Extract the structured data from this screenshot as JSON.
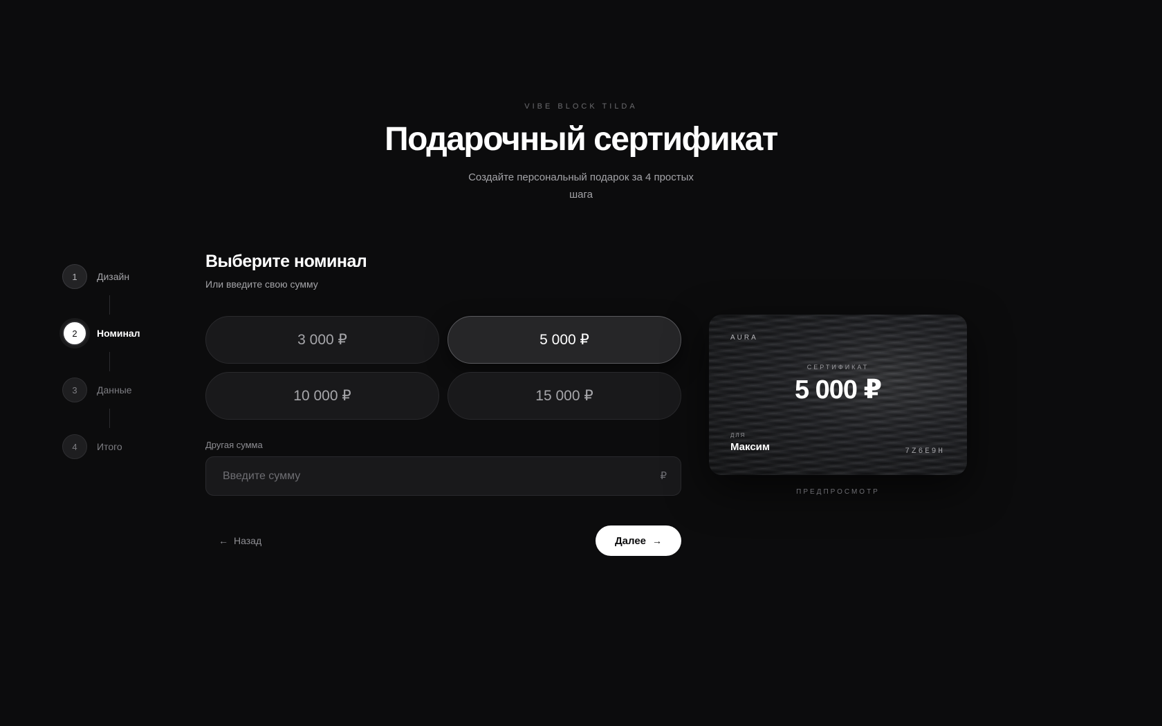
{
  "header": {
    "eyebrow": "VIBE BLOCK TILDA",
    "title": "Подарочный сертификат",
    "subtitle": "Создайте персональный подарок за 4 простых шага"
  },
  "stepper": {
    "steps": [
      {
        "number": "1",
        "label": "Дизайн",
        "state": "done"
      },
      {
        "number": "2",
        "label": "Номинал",
        "state": "active"
      },
      {
        "number": "3",
        "label": "Данные",
        "state": "pending"
      },
      {
        "number": "4",
        "label": "Итого",
        "state": "pending"
      }
    ]
  },
  "main": {
    "title": "Выберите номинал",
    "subtitle": "Или введите свою сумму",
    "amounts": [
      {
        "label": "3 000 ₽",
        "selected": false
      },
      {
        "label": "5 000 ₽",
        "selected": true
      },
      {
        "label": "10 000 ₽",
        "selected": false
      },
      {
        "label": "15 000 ₽",
        "selected": false
      }
    ],
    "custom_amount": {
      "label": "Другая сумма",
      "placeholder": "Введите сумму",
      "value": "",
      "currency": "₽"
    },
    "back_label": "Назад",
    "next_label": "Далее"
  },
  "preview": {
    "brand": "AURA",
    "cert_label": "СЕРТИФИКАТ",
    "amount": "5 000 ₽",
    "for_label": "ДЛЯ",
    "recipient": "Максим",
    "code": "7Z6E9H",
    "caption": "ПРЕДПРОСМОТР"
  },
  "colors": {
    "background": "#0c0c0d",
    "surface": "#19191b",
    "accent": "#ffffff",
    "muted_text": "#a4a4a8"
  },
  "icons": {
    "back": "arrow-left-icon",
    "next": "arrow-right-icon",
    "currency": "ruble-icon"
  }
}
